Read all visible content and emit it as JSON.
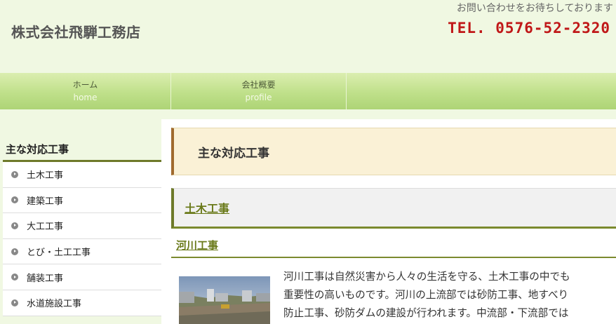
{
  "header": {
    "site_title": "株式会社飛騨工務店",
    "contact_message": "お問い合わせをお待ちしております",
    "tel": "TEL. 0576-52-2320"
  },
  "gnav": [
    {
      "jp": "ホーム",
      "en": "home"
    },
    {
      "jp": "会社概要",
      "en": "profile"
    }
  ],
  "sidebar": {
    "title": "主な対応工事",
    "items": [
      "土木工事",
      "建築工事",
      "大工工事",
      "とび・土工工事",
      "舗装工事",
      "水道施設工事"
    ]
  },
  "main": {
    "page_heading": "主な対応工事",
    "section_heading": "土木工事",
    "sub_heading": "河川工事",
    "body_lines": [
      "河川工事は自然災害から人々の生活を守る、土木工事の中でも",
      "重要性の高いものです。河川の上流部では砂防工事、地すべり",
      "防止工事、砂防ダムの建設が行われます。中流部・下流部では"
    ]
  },
  "colors": {
    "background": "#f0f8e2",
    "nav_green": "#bfe08a",
    "tel_red": "#c01818",
    "accent_olive": "#6e7a2a",
    "heading_brown": "#a06a2e"
  }
}
